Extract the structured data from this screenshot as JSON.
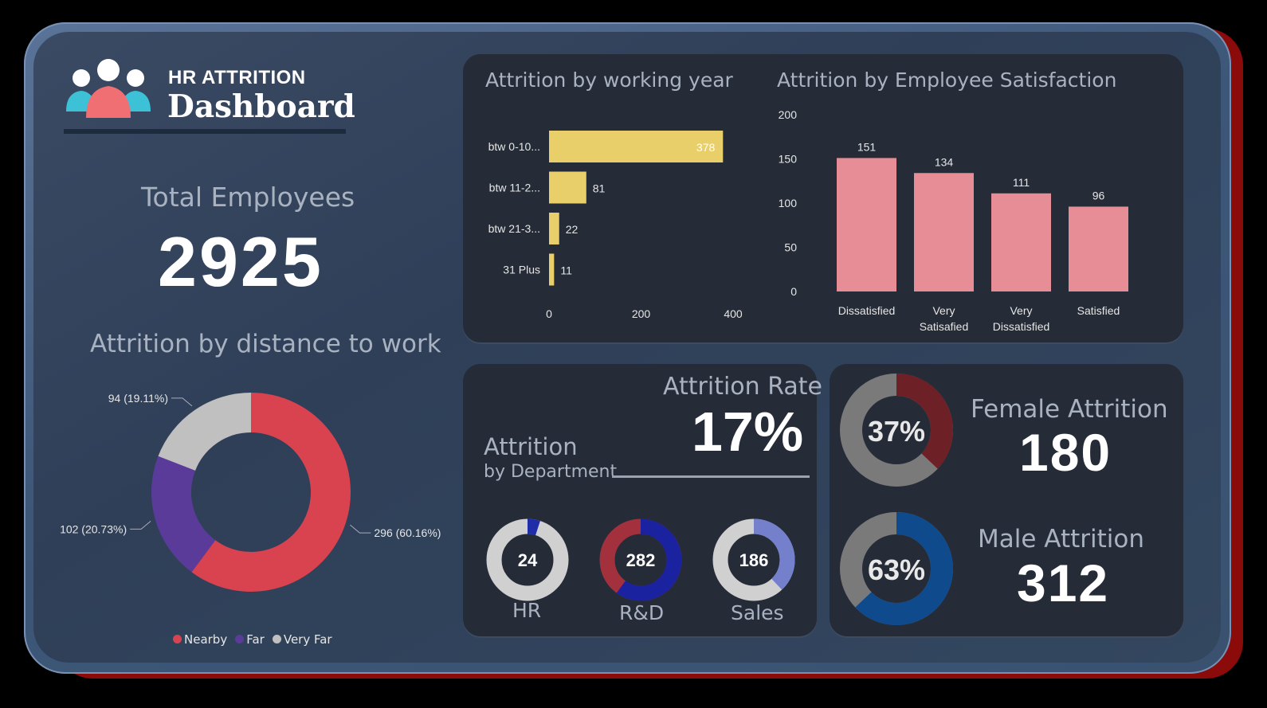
{
  "header": {
    "title_small": "HR ATTRITION",
    "title_large": "Dashboard",
    "logo_icon": "people-group-icon"
  },
  "total": {
    "label": "Total Employees",
    "value": "2925"
  },
  "distance": {
    "title": "Attrition by distance to work",
    "legend": [
      {
        "name": "Nearby",
        "color": "#d9434f"
      },
      {
        "name": "Far",
        "color": "#5b3b9a"
      },
      {
        "name": "Very Far",
        "color": "#c0c0c0"
      }
    ]
  },
  "working_year": {
    "title": "Attrition by working year"
  },
  "satisfaction": {
    "title": "Attrition by Employee Satisfaction"
  },
  "department": {
    "title": "Attrition",
    "subtitle": "by Department",
    "rate_label": "Attrition Rate",
    "rate_value": "17%",
    "items": [
      {
        "name": "HR",
        "value": "24",
        "pct": 0.05,
        "color": "#1f2ea8",
        "rest": "#d0d0d0"
      },
      {
        "name": "R&D",
        "value": "282",
        "pct": 0.6,
        "color": "#1b22a0",
        "rest": "#a3303d"
      },
      {
        "name": "Sales",
        "value": "186",
        "pct": 0.38,
        "color": "#7580cc",
        "rest": "#d0d0d0"
      }
    ]
  },
  "gender": {
    "female": {
      "label": "Female Attrition",
      "value": "180",
      "pct_text": "37%",
      "pct": 0.37,
      "color": "#6e2027",
      "rest": "#7a7a7a"
    },
    "male": {
      "label": "Male Attrition",
      "value": "312",
      "pct_text": "63%",
      "pct": 0.63,
      "color": "#0f4a8c",
      "rest": "#7a7a7a"
    }
  },
  "chart_data": [
    {
      "type": "pie",
      "title": "Attrition by distance to work",
      "categories": [
        "Nearby",
        "Far",
        "Very Far"
      ],
      "values": [
        296,
        102,
        94
      ],
      "labels": [
        "296 (60.16%)",
        "102 (20.73%)",
        "94 (19.11%)"
      ],
      "colors": [
        "#d9434f",
        "#5b3b9a",
        "#c0c0c0"
      ],
      "legend": "bottom"
    },
    {
      "type": "bar",
      "orientation": "horizontal",
      "title": "Attrition by working year",
      "categories": [
        "btw 0-10...",
        "btw 11-2...",
        "btw 21-3...",
        "31 Plus"
      ],
      "values": [
        378,
        81,
        22,
        11
      ],
      "xlim": [
        0,
        400
      ],
      "xticks": [
        0,
        200,
        400
      ],
      "color": "#e8cf6a"
    },
    {
      "type": "bar",
      "title": "Attrition by Employee Satisfaction",
      "categories": [
        "Dissatisfied",
        "Very Satisafied",
        "Very Dissatisfied",
        "Satisfied"
      ],
      "values": [
        151,
        134,
        111,
        96
      ],
      "ylim": [
        0,
        200
      ],
      "yticks": [
        0,
        50,
        100,
        150,
        200
      ],
      "color": "#e68d95"
    }
  ]
}
